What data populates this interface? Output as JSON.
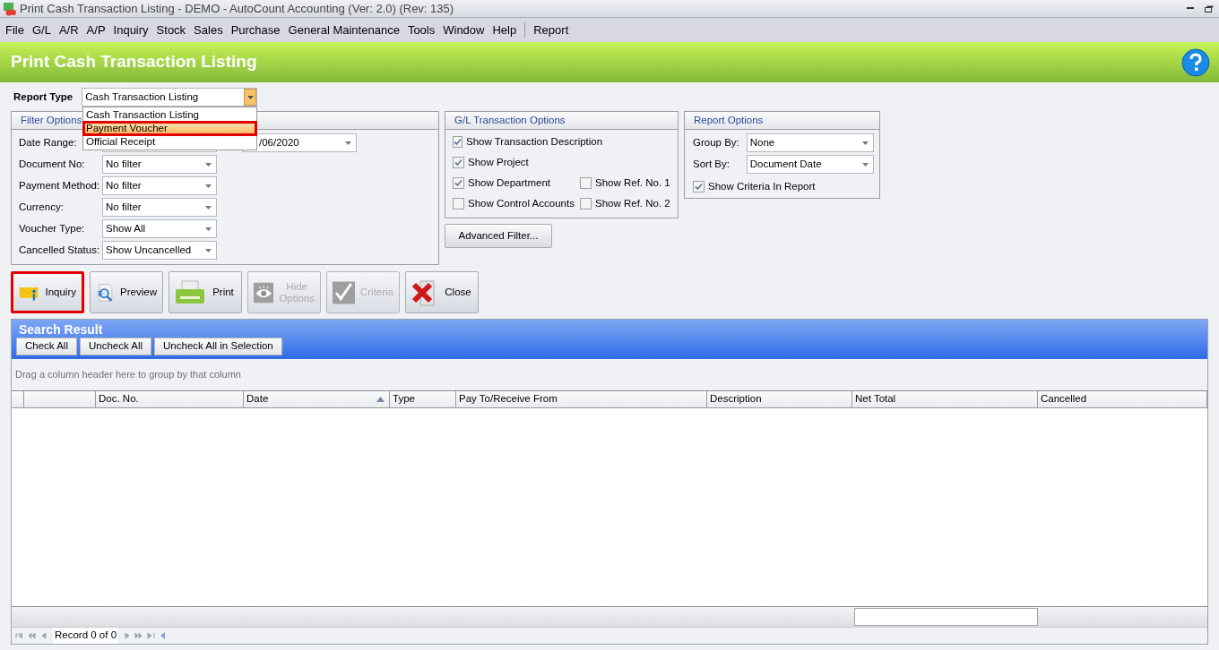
{
  "window": {
    "title": "Print Cash Transaction Listing - DEMO - AutoCount Accounting (Ver: 2.0) (Rev: 135)"
  },
  "menu": [
    "File",
    "G/L",
    "A/R",
    "A/P",
    "Inquiry",
    "Stock",
    "Sales",
    "Purchase",
    "General Maintenance",
    "Tools",
    "Window",
    "Help",
    "Report"
  ],
  "page_title": "Print Cash Transaction Listing",
  "report_type": {
    "label": "Report Type",
    "value": "Cash Transaction Listing",
    "expanded": true,
    "options": [
      {
        "label": "Cash Transaction Listing",
        "highlighted": false
      },
      {
        "label": "Payment Voucher",
        "highlighted": true
      },
      {
        "label": "Official Receipt",
        "highlighted": false
      }
    ]
  },
  "filter_options": {
    "title": "Filter Options",
    "date_range": {
      "label": "Date Range:",
      "value_to": "/06/2020"
    },
    "fields": [
      {
        "label": "Document No:",
        "value": "No filter"
      },
      {
        "label": "Payment Method:",
        "value": "No filter"
      },
      {
        "label": "Currency:",
        "value": "No filter"
      },
      {
        "label": "Voucher Type:",
        "value": "Show All"
      },
      {
        "label": "Cancelled Status:",
        "value": "Show Uncancelled"
      }
    ]
  },
  "gl_options": {
    "title": "G/L Transaction Options",
    "rows": [
      {
        "checkboxes": [
          {
            "label": "Show Transaction Description",
            "checked": true
          }
        ]
      },
      {
        "checkboxes": [
          {
            "label": "Show Project",
            "checked": true
          }
        ]
      },
      {
        "checkboxes": [
          {
            "label": "Show Department",
            "checked": true
          },
          {
            "label": "Show Ref. No. 1",
            "checked": false
          }
        ]
      },
      {
        "checkboxes": [
          {
            "label": "Show Control Accounts",
            "checked": false
          },
          {
            "label": "Show Ref. No. 2",
            "checked": false
          }
        ]
      }
    ]
  },
  "report_options": {
    "title": "Report Options",
    "fields": [
      {
        "label": "Group By:",
        "value": "None"
      },
      {
        "label": "Sort By:",
        "value": "Document Date"
      }
    ],
    "checkboxes": [
      {
        "label": "Show Criteria In Report",
        "checked": true
      }
    ]
  },
  "advanced_filter_button": "Advanced Filter...",
  "actions": [
    {
      "label": "Inquiry",
      "kind": "inquiry",
      "disabled": false,
      "highlighted": true
    },
    {
      "label": "Preview",
      "kind": "preview",
      "disabled": false,
      "highlighted": false
    },
    {
      "label": "Print",
      "kind": "print",
      "disabled": false,
      "highlighted": false
    },
    {
      "label": "Hide Options",
      "kind": "visibility",
      "disabled": true,
      "highlighted": false
    },
    {
      "label": "Criteria",
      "kind": "criteria",
      "disabled": true,
      "highlighted": false
    },
    {
      "label": "Close",
      "kind": "close",
      "disabled": false,
      "highlighted": false
    }
  ],
  "search_result": {
    "title": "Search Result",
    "buttons": [
      "Check All",
      "Uncheck All",
      "Uncheck All in Selection"
    ],
    "group_hint": "Drag a column header here to group by that column",
    "columns": [
      {
        "label": "Doc. No.",
        "sorted": false
      },
      {
        "label": "Date",
        "sorted": true
      },
      {
        "label": "Type",
        "sorted": false
      },
      {
        "label": "Pay To/Receive From",
        "sorted": false
      },
      {
        "label": "Description",
        "sorted": false
      },
      {
        "label": "Net Total",
        "sorted": false
      },
      {
        "label": "Cancelled",
        "sorted": false
      }
    ],
    "navigator": {
      "record": "Record 0 of 0"
    }
  }
}
